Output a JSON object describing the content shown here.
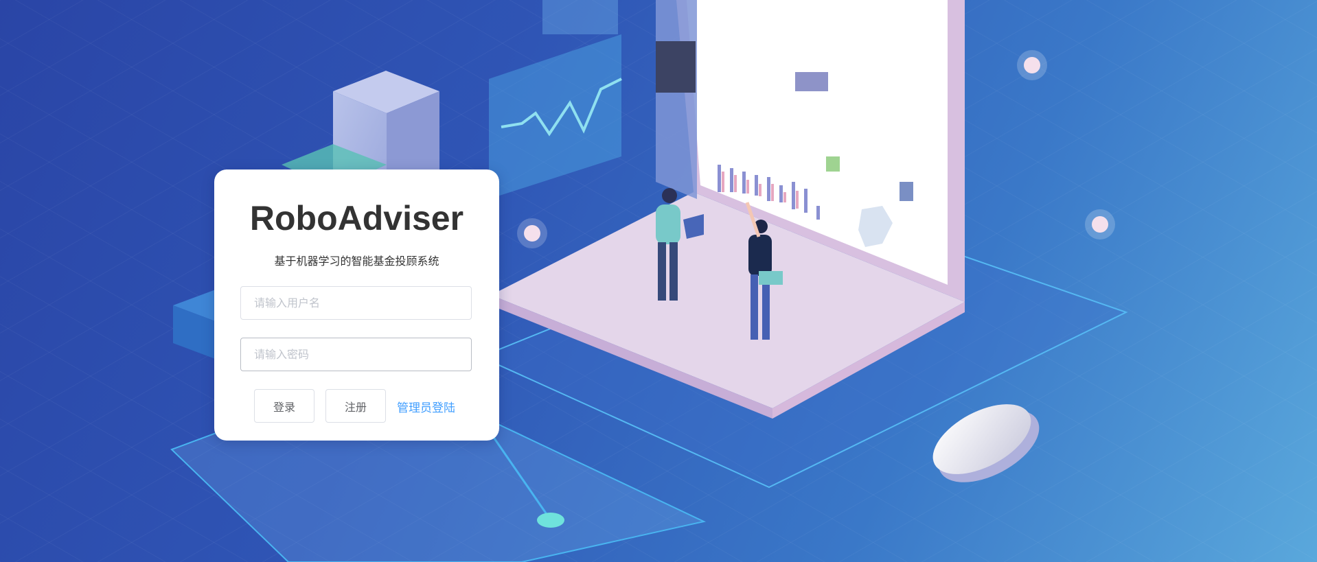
{
  "login": {
    "title": "RoboAdviser",
    "subtitle": "基于机器学习的智能基金投顾系统",
    "username_placeholder": "请输入用户名",
    "username_value": "",
    "password_placeholder": "请输入密码",
    "password_value": "",
    "login_label": "登录",
    "register_label": "注册",
    "admin_login_label": "管理员登陆"
  },
  "colors": {
    "background_start": "#2a45a6",
    "background_end": "#5aa8dc",
    "card": "#ffffff",
    "title_text": "#333333",
    "link": "#409eff"
  }
}
